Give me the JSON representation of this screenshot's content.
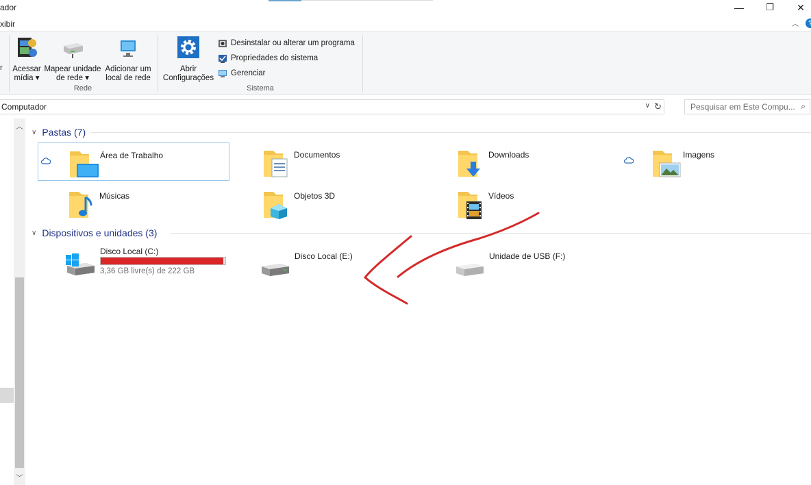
{
  "window": {
    "title": "ador",
    "tab": "xibir",
    "minimize": "—",
    "maximize": "❐",
    "close": "✕",
    "collapse": "︿",
    "help": "?"
  },
  "ribbon": {
    "left_cut": "r",
    "acessar_midia": {
      "line1": "Acessar",
      "line2": "mídia ▾"
    },
    "mapear": {
      "line1": "Mapear unidade",
      "line2": "de rede ▾"
    },
    "adicionar": {
      "line1": "Adicionar um",
      "line2": "local de rede"
    },
    "rede_label": "Rede",
    "abrir_config": {
      "line1": "Abrir",
      "line2": "Configurações"
    },
    "desinstalar": "Desinstalar ou alterar um programa",
    "propriedades": "Propriedades do sistema",
    "gerenciar": "Gerenciar",
    "sistema_label": "Sistema"
  },
  "address": {
    "path": "Computador",
    "search_placeholder": "Pesquisar em Este Compu..."
  },
  "folders_group": {
    "title": "Pastas (7)",
    "items": [
      {
        "label": "Área de Trabalho",
        "icon": "desktop-folder-icon",
        "cloud": true
      },
      {
        "label": "Documentos",
        "icon": "documents-folder-icon",
        "cloud": false
      },
      {
        "label": "Downloads",
        "icon": "downloads-folder-icon",
        "cloud": false
      },
      {
        "label": "Imagens",
        "icon": "pictures-folder-icon",
        "cloud": true
      },
      {
        "label": "Músicas",
        "icon": "music-folder-icon",
        "cloud": false
      },
      {
        "label": "Objetos 3D",
        "icon": "3d-objects-folder-icon",
        "cloud": false
      },
      {
        "label": "Vídeos",
        "icon": "videos-folder-icon",
        "cloud": false
      }
    ]
  },
  "devices_group": {
    "title": "Dispositivos e unidades (3)",
    "items": [
      {
        "label": "Disco Local (C:)",
        "free": "3,36 GB livre(s) de 222 GB",
        "used_fraction": 0.985,
        "bar_color": "#da2626"
      },
      {
        "label": "Disco Local (E:)"
      },
      {
        "label": "Unidade de USB (F:)"
      }
    ]
  },
  "colors": {
    "group_heading": "#1e3287",
    "annotation_stroke": "#d42a2a",
    "selection_border": "#99c9ef"
  }
}
